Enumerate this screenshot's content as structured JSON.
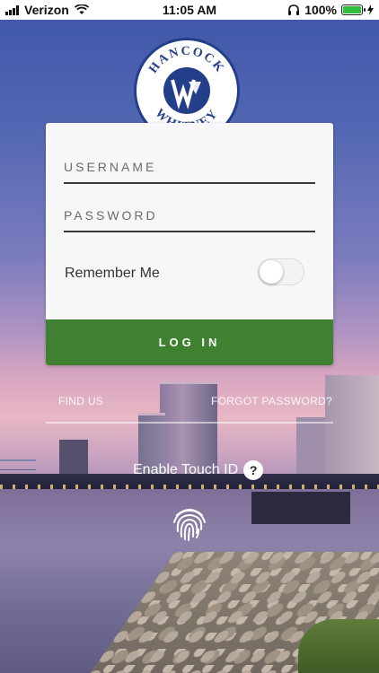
{
  "status_bar": {
    "carrier": "Verizon",
    "time": "11:05 AM",
    "battery": "100%"
  },
  "brand": {
    "top_text": "HANCOCK",
    "bottom_text": "WHITNEY",
    "colors": {
      "primary": "#243f8a",
      "accent_green": "#3f8031"
    }
  },
  "login": {
    "username_placeholder": "USERNAME",
    "password_placeholder": "PASSWORD",
    "remember_label": "Remember Me",
    "remember_on": false,
    "login_button": "LOG IN"
  },
  "links": {
    "find_us": "FIND US",
    "forgot_password": "FORGOT PASSWORD?"
  },
  "touch_id": {
    "label": "Enable Touch ID",
    "help_symbol": "?"
  },
  "icons": [
    "signal-icon",
    "wifi-icon",
    "headphones-icon",
    "battery-icon",
    "charging-icon",
    "logo-icon",
    "help-icon",
    "fingerprint-icon"
  ]
}
